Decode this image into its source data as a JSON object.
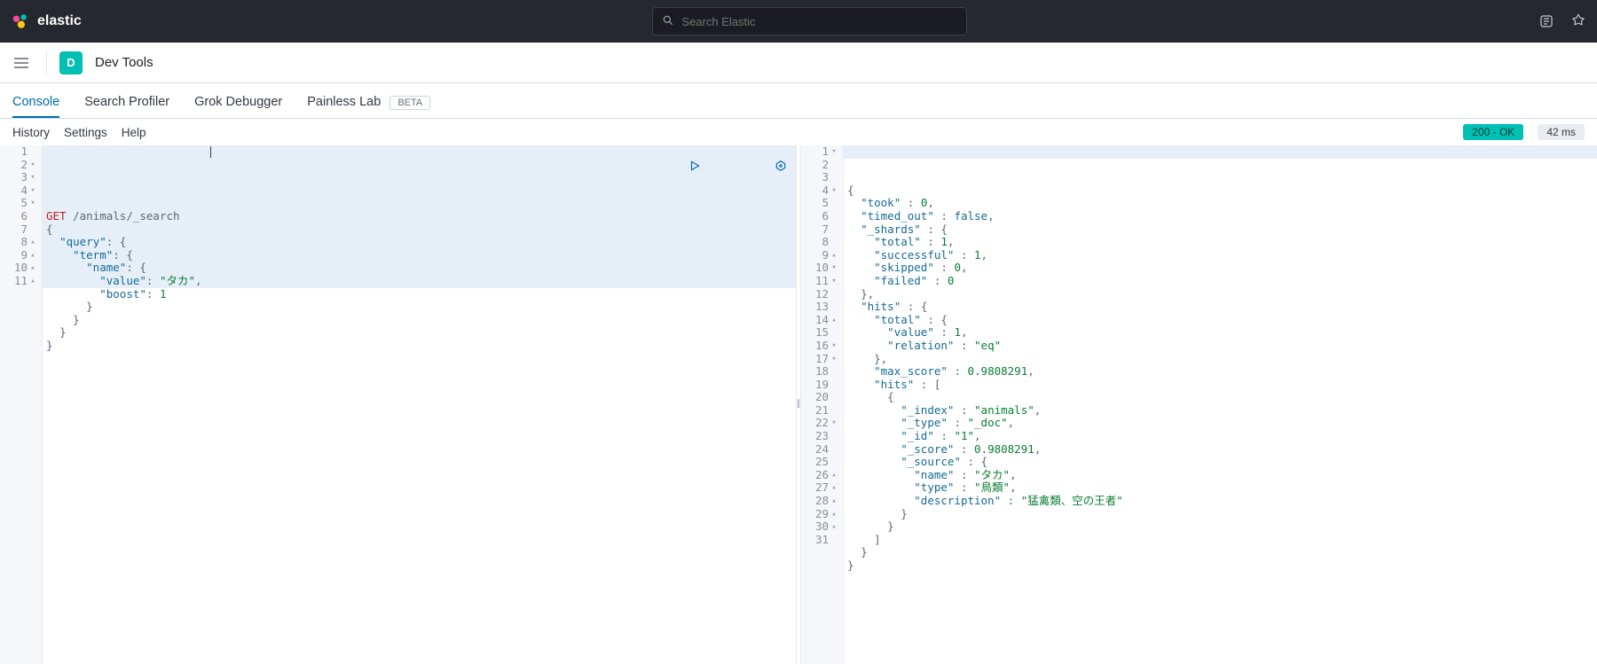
{
  "header": {
    "brand": "elastic",
    "search_placeholder": "Search Elastic"
  },
  "breadcrumb": {
    "app_badge": "D",
    "app_label": "Dev Tools"
  },
  "tabs": {
    "items": [
      {
        "label": "Console",
        "active": true
      },
      {
        "label": "Search Profiler",
        "active": false
      },
      {
        "label": "Grok Debugger",
        "active": false
      },
      {
        "label": "Painless Lab",
        "active": false,
        "beta": true
      }
    ],
    "beta_label": "BETA"
  },
  "toolbar": {
    "history": "History",
    "settings": "Settings",
    "help": "Help",
    "status": "200 - OK",
    "time": "42 ms"
  },
  "request": {
    "method": "GET",
    "path": "/animals/_search",
    "lines": [
      {
        "n": 1,
        "fold": ""
      },
      {
        "n": 2,
        "fold": "▾"
      },
      {
        "n": 3,
        "fold": "▾"
      },
      {
        "n": 4,
        "fold": "▾"
      },
      {
        "n": 5,
        "fold": "▾"
      },
      {
        "n": 6,
        "fold": ""
      },
      {
        "n": 7,
        "fold": ""
      },
      {
        "n": 8,
        "fold": "▴"
      },
      {
        "n": 9,
        "fold": "▴"
      },
      {
        "n": 10,
        "fold": "▴"
      },
      {
        "n": 11,
        "fold": "▴"
      }
    ],
    "body": {
      "query": {
        "term": {
          "name": {
            "value": "タカ",
            "boost": 1
          }
        }
      }
    }
  },
  "response": {
    "lines": [
      {
        "n": 1,
        "fold": "▾"
      },
      {
        "n": 2,
        "fold": ""
      },
      {
        "n": 3,
        "fold": ""
      },
      {
        "n": 4,
        "fold": "▾"
      },
      {
        "n": 5,
        "fold": ""
      },
      {
        "n": 6,
        "fold": ""
      },
      {
        "n": 7,
        "fold": ""
      },
      {
        "n": 8,
        "fold": ""
      },
      {
        "n": 9,
        "fold": "▴"
      },
      {
        "n": 10,
        "fold": "▾"
      },
      {
        "n": 11,
        "fold": "▾"
      },
      {
        "n": 12,
        "fold": ""
      },
      {
        "n": 13,
        "fold": ""
      },
      {
        "n": 14,
        "fold": "▴"
      },
      {
        "n": 15,
        "fold": ""
      },
      {
        "n": 16,
        "fold": "▾"
      },
      {
        "n": 17,
        "fold": "▾"
      },
      {
        "n": 18,
        "fold": ""
      },
      {
        "n": 19,
        "fold": ""
      },
      {
        "n": 20,
        "fold": ""
      },
      {
        "n": 21,
        "fold": ""
      },
      {
        "n": 22,
        "fold": "▾"
      },
      {
        "n": 23,
        "fold": ""
      },
      {
        "n": 24,
        "fold": ""
      },
      {
        "n": 25,
        "fold": ""
      },
      {
        "n": 26,
        "fold": "▴"
      },
      {
        "n": 27,
        "fold": "▴"
      },
      {
        "n": 28,
        "fold": "▴"
      },
      {
        "n": 29,
        "fold": "▴"
      },
      {
        "n": 30,
        "fold": "▴"
      },
      {
        "n": 31,
        "fold": ""
      }
    ],
    "body": {
      "took": 0,
      "timed_out": false,
      "_shards": {
        "total": 1,
        "successful": 1,
        "skipped": 0,
        "failed": 0
      },
      "hits": {
        "total": {
          "value": 1,
          "relation": "eq"
        },
        "max_score": 0.9808291,
        "hits": [
          {
            "_index": "animals",
            "_type": "_doc",
            "_id": "1",
            "_score": 0.9808291,
            "_source": {
              "name": "タカ",
              "type": "鳥類",
              "description": "猛禽類、空の王者"
            }
          }
        ]
      }
    }
  }
}
